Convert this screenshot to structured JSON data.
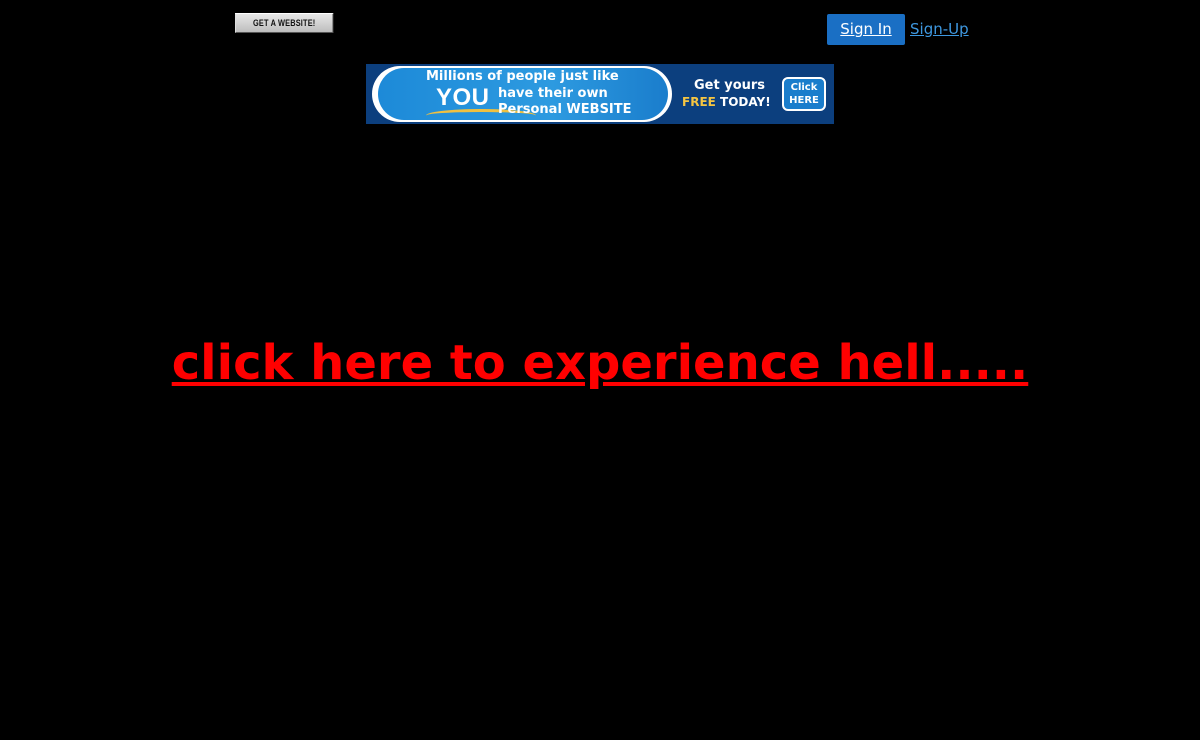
{
  "header": {
    "get_website_label": "GET A WEBSITE!",
    "sign_in_label": "Sign In",
    "sign_up_label": "Sign-Up"
  },
  "banner": {
    "line1": "Millions of people just like",
    "you": "YOU",
    "line2": "have their own",
    "line3": "Personal WEBSITE",
    "get_yours": "Get yours",
    "free": "FREE",
    "today": "TODAY!",
    "click_line1": "Click",
    "click_line2": "HERE"
  },
  "main": {
    "link_text": "click here to experience hell....."
  },
  "colors": {
    "background": "#000000",
    "link": "#ff0000",
    "sign_in_bg": "#1a6fc4",
    "sign_up_link": "#3e98e0"
  }
}
